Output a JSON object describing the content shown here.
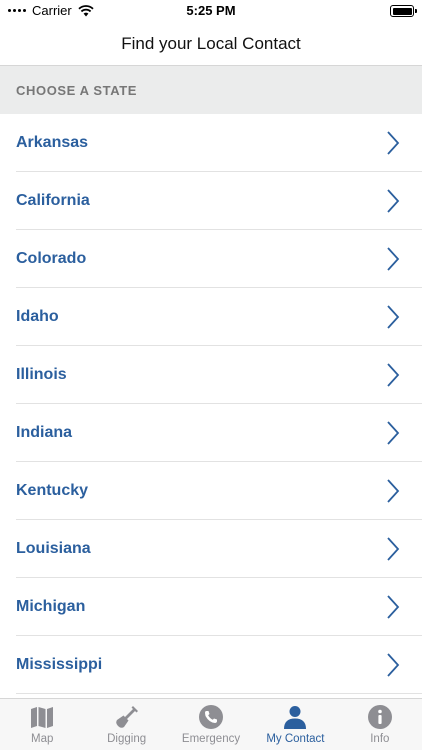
{
  "status_bar": {
    "carrier": "Carrier",
    "time": "5:25 PM",
    "battery_level_percent": 100
  },
  "nav": {
    "title": "Find your Local Contact"
  },
  "section": {
    "header": "CHOOSE A STATE"
  },
  "states": [
    {
      "label": "Arkansas"
    },
    {
      "label": "California"
    },
    {
      "label": "Colorado"
    },
    {
      "label": "Idaho"
    },
    {
      "label": "Illinois"
    },
    {
      "label": "Indiana"
    },
    {
      "label": "Kentucky"
    },
    {
      "label": "Louisiana"
    },
    {
      "label": "Michigan"
    },
    {
      "label": "Mississippi"
    }
  ],
  "tabs": [
    {
      "label": "Map",
      "icon": "map-icon"
    },
    {
      "label": "Digging",
      "icon": "shovel-icon"
    },
    {
      "label": "Emergency",
      "icon": "phone-icon"
    },
    {
      "label": "My Contact",
      "icon": "person-icon"
    },
    {
      "label": "Info",
      "icon": "info-icon"
    }
  ],
  "colors": {
    "accent": "#2b5f9e",
    "inactive_tab": "#8e8e93",
    "section_background": "#ebecec"
  }
}
